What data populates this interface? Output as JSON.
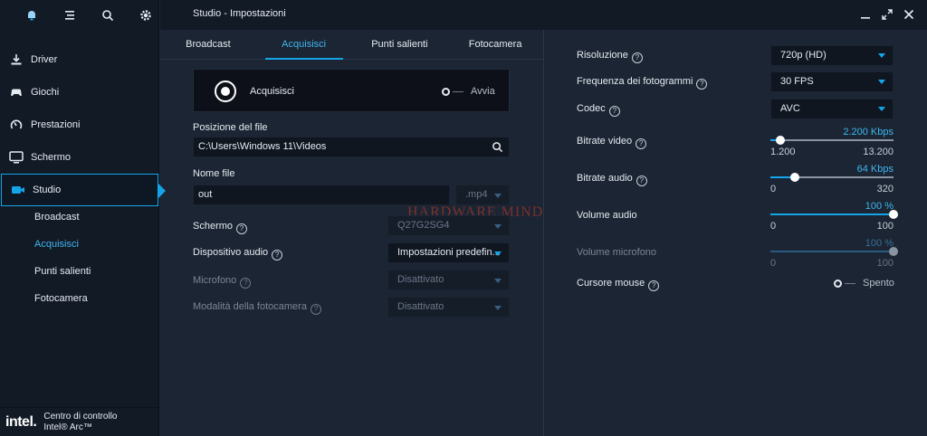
{
  "window": {
    "title": "Studio - Impostazioni"
  },
  "sidebar": {
    "items": [
      {
        "label": "Driver",
        "icon": "download-icon"
      },
      {
        "label": "Giochi",
        "icon": "gamepad-icon"
      },
      {
        "label": "Prestazioni",
        "icon": "gauge-icon"
      },
      {
        "label": "Schermo",
        "icon": "monitor-icon"
      },
      {
        "label": "Studio",
        "icon": "camera-icon"
      }
    ],
    "subitems": [
      "Broadcast",
      "Acquisisci",
      "Punti salienti",
      "Fotocamera"
    ],
    "brand": {
      "logo": "intel.",
      "line1": "Centro di controllo",
      "line2": "Intel® Arc™"
    }
  },
  "tabs": [
    "Broadcast",
    "Acquisisci",
    "Punti salienti",
    "Fotocamera"
  ],
  "capture": {
    "label": "Acquisisci",
    "toggle_label": "Avvia",
    "file_path_label": "Posizione del file",
    "file_path_value": "C:\\Users\\Windows 11\\Videos",
    "file_name_label": "Nome file",
    "file_name_value": "out",
    "file_ext": ".mp4",
    "screen_label": "Schermo",
    "screen_value": "Q27G2SG4",
    "audio_device_label": "Dispositivo audio",
    "audio_device_value": "Impostazioni predefin...",
    "mic_label": "Microfono",
    "mic_value": "Disattivato",
    "camera_mode_label": "Modalità della fotocamera",
    "camera_mode_value": "Disattivato"
  },
  "watermark": "HARDWARE MIND",
  "settings": {
    "resolution_label": "Risoluzione",
    "resolution_value": "720p (HD)",
    "framerate_label": "Frequenza dei fotogrammi",
    "framerate_value": "30 FPS",
    "codec_label": "Codec",
    "codec_value": "AVC",
    "video_bitrate_label": "Bitrate video",
    "video_bitrate": {
      "value": "2.200 Kbps",
      "min": "1.200",
      "max": "13.200",
      "fraction": 0.083
    },
    "audio_bitrate_label": "Bitrate audio",
    "audio_bitrate": {
      "value": "64 Kbps",
      "min": "0",
      "max": "320",
      "fraction": 0.2
    },
    "audio_volume_label": "Volume audio",
    "audio_volume": {
      "value": "100 %",
      "min": "0",
      "max": "100",
      "fraction": 1.0
    },
    "mic_volume_label": "Volume microfono",
    "mic_volume": {
      "value": "100 %",
      "min": "0",
      "max": "100",
      "fraction": 1.0
    },
    "cursor_label": "Cursore mouse",
    "cursor_toggle": "Spento"
  },
  "colors": {
    "accent": "#15a4e8",
    "bg": "#1b2533",
    "sidebar": "#121a26"
  }
}
